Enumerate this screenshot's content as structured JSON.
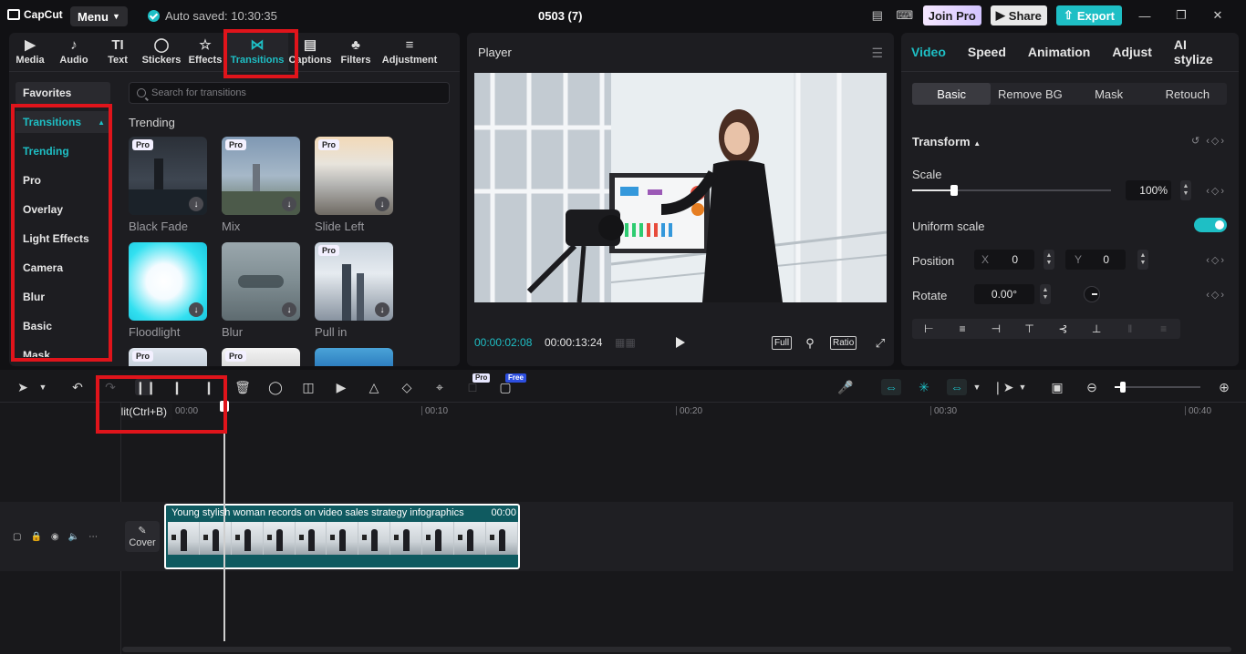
{
  "titlebar": {
    "logo": "CapCut",
    "menu_label": "Menu",
    "autosave": "Auto saved: 10:30:35",
    "project_title": "0503 (7)",
    "join_pro": "Join Pro",
    "share": "Share",
    "export": "Export"
  },
  "tools": [
    {
      "label": "Media",
      "icon": "media-icon"
    },
    {
      "label": "Audio",
      "icon": "audio-icon"
    },
    {
      "label": "Text",
      "icon": "text-icon"
    },
    {
      "label": "Stickers",
      "icon": "stickers-icon"
    },
    {
      "label": "Effects",
      "icon": "effects-icon"
    },
    {
      "label": "Transitions",
      "icon": "transitions-icon",
      "active": true
    },
    {
      "label": "Captions",
      "icon": "captions-icon"
    },
    {
      "label": "Filters",
      "icon": "filters-icon"
    },
    {
      "label": "Adjustment",
      "icon": "adjustment-icon"
    }
  ],
  "sidebar": {
    "favorites": "Favorites",
    "header": "Transitions",
    "items": [
      "Trending",
      "Pro",
      "Overlay",
      "Light Effects",
      "Camera",
      "Blur",
      "Basic",
      "Mask"
    ]
  },
  "search": {
    "placeholder": "Search for transitions"
  },
  "section": "Trending",
  "thumbnails": [
    {
      "label": "Black Fade",
      "pro": "Pro"
    },
    {
      "label": "Mix",
      "pro": "Pro"
    },
    {
      "label": "Slide Left",
      "pro": "Pro"
    },
    {
      "label": "Floodlight",
      "pro": ""
    },
    {
      "label": "Blur",
      "pro": ""
    },
    {
      "label": "Pull in",
      "pro": "Pro"
    },
    {
      "label": "",
      "pro": "Pro"
    },
    {
      "label": "",
      "pro": "Pro"
    },
    {
      "label": "",
      "pro": ""
    }
  ],
  "player": {
    "title": "Player",
    "current_time": "00:00:02:08",
    "duration": "00:00:13:24",
    "full": "Full",
    "ratio": "Ratio"
  },
  "inspector": {
    "tabs": [
      "Video",
      "Speed",
      "Animation",
      "Adjust",
      "AI stylize"
    ],
    "subtabs": [
      "Basic",
      "Remove BG",
      "Mask",
      "Retouch"
    ],
    "transform": "Transform",
    "scale_label": "Scale",
    "scale_value": "100%",
    "uniform_scale": "Uniform scale",
    "position_label": "Position",
    "x_label": "X",
    "x_value": "0",
    "y_label": "Y",
    "y_value": "0",
    "rotate_label": "Rotate",
    "rotate_value": "0.00°"
  },
  "timeline": {
    "tooltip": "Split(Ctrl+B)",
    "pro_badge": "Pro",
    "free_badge": "Free",
    "ruler": [
      "00:00",
      "00:10",
      "00:20",
      "00:30",
      "00:40"
    ],
    "cover": "Cover",
    "clip_title": "Young stylish woman records on video sales strategy infographics",
    "clip_duration": "00:00"
  },
  "colors": {
    "accent": "#1ebfc5",
    "annotation": "#e0141b"
  }
}
